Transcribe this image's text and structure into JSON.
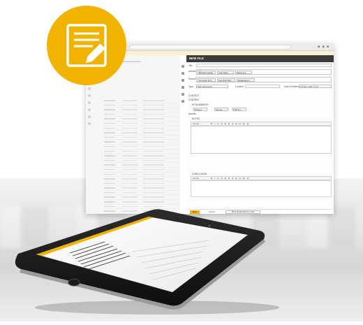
{
  "colors": {
    "accent": "#f0b400",
    "panel_header": "#3b3b3b",
    "tablet_body": "#1c1c1c"
  },
  "badge": {
    "icon": "document-edit-icon"
  },
  "screenshot": {
    "panel_title": "NEW FILE",
    "fields": {
      "title_label": "Title",
      "attendees_label": "Attendees",
      "attendee_chips": [
        "Bertrand Jordan",
        "Yves Durin",
        "Daniel Lux"
      ],
      "references_label": "References",
      "reference_chips": [
        "Key Point XYV",
        "Key Point BTC",
        "Rettenbach 1"
      ],
      "type_label": "Type",
      "type_value": "Risk assessment",
      "location_label": "Location",
      "date_label": "Date of Meeting",
      "date_value": "12 Feb. 2014, 11:15"
    },
    "sections": {
      "context": "CONTEXT",
      "content": "CONTENT",
      "attachments": "ATTACHMENTS",
      "attachment_chips": [
        "Pictures",
        "Cat.doc",
        "PPT.jpg"
      ],
      "add_file": "Add file",
      "notes": "NOTES",
      "conclusion": "CONCLUSION"
    },
    "editor": {
      "format_label": "Format",
      "tools": "B I U S E E 3 E H ⊞ ⊟"
    },
    "footer": {
      "save": "Save",
      "cancel": "Cancel",
      "move": "Move all attendees by email"
    }
  }
}
